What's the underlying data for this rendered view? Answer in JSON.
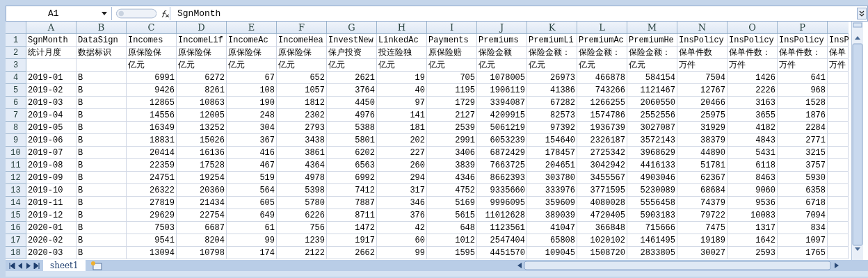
{
  "name_box": "A1",
  "formula": "SgnMonth",
  "columns": [
    "A",
    "B",
    "C",
    "D",
    "E",
    "F",
    "G",
    "H",
    "I",
    "J",
    "K",
    "L",
    "M",
    "N",
    "O",
    "P"
  ],
  "rows": [
    {
      "number": "1",
      "cells": [
        "SgnMonth",
        "DataSign",
        "Incomes",
        "IncomeLif",
        "IncomeAc",
        "IncomeHea",
        "InvestNew",
        "LinkedAc",
        "Payments",
        "Premiums",
        "PremiumLi",
        "PremiumAc",
        "PremiumHe",
        "InsPolicy",
        "InsPolicy",
        "InsPolicy",
        "InsP"
      ]
    },
    {
      "number": "2",
      "cells": [
        "统计月度",
        "数据标识",
        "原保险保",
        "原保险保",
        "原保险保",
        "原保险保",
        "保户投资",
        "投连险独",
        "原保险赔",
        "保险金额",
        "保险金额：",
        "保险金额：",
        "保险金额：",
        "保单件数",
        "保单件数：",
        "保单件数：",
        "保单"
      ]
    },
    {
      "number": "3",
      "cells": [
        null,
        null,
        "亿元",
        "亿元",
        "亿元",
        "亿元",
        "亿元",
        "亿元",
        "亿元",
        "亿元",
        "亿元",
        "亿元",
        "亿元",
        "万件",
        "万件",
        "万件",
        "万件"
      ]
    },
    {
      "number": "4",
      "cells": [
        "2019-01",
        "B",
        "6991",
        "6272",
        "67",
        "652",
        "2621",
        "19",
        "705",
        "1078005",
        "26973",
        "466878",
        "584154",
        "7504",
        "1426",
        "641"
      ]
    },
    {
      "number": "5",
      "cells": [
        "2019-02",
        "B",
        "9426",
        "8261",
        "108",
        "1057",
        "3764",
        "40",
        "1195",
        "1906119",
        "41386",
        "743266",
        "1121467",
        "12767",
        "2226",
        "968"
      ]
    },
    {
      "number": "6",
      "cells": [
        "2019-03",
        "B",
        "12865",
        "10863",
        "190",
        "1812",
        "4450",
        "97",
        "1729",
        "3394087",
        "67282",
        "1266255",
        "2060550",
        "20466",
        "3163",
        "1528"
      ]
    },
    {
      "number": "7",
      "cells": [
        "2019-04",
        "B",
        "14556",
        "12005",
        "248",
        "2302",
        "4976",
        "141",
        "2127",
        "4209915",
        "82573",
        "1574786",
        "2552556",
        "25975",
        "3655",
        "1876"
      ]
    },
    {
      "number": "8",
      "cells": [
        "2019-05",
        "B",
        "16349",
        "13252",
        "304",
        "2793",
        "5388",
        "181",
        "2539",
        "5061219",
        "97392",
        "1936739",
        "3027087",
        "31929",
        "4182",
        "2284"
      ]
    },
    {
      "number": "9",
      "cells": [
        "2019-06",
        "B",
        "18831",
        "15026",
        "367",
        "3438",
        "5801",
        "202",
        "2991",
        "6053239",
        "154640",
        "2326187",
        "3572143",
        "38379",
        "4843",
        "2771"
      ]
    },
    {
      "number": "10",
      "cells": [
        "2019-07",
        "B",
        "20414",
        "16136",
        "416",
        "3861",
        "6202",
        "227",
        "3406",
        "6872429",
        "178457",
        "2725342",
        "3968629",
        "44890",
        "5431",
        "3215"
      ]
    },
    {
      "number": "11",
      "cells": [
        "2019-08",
        "B",
        "22359",
        "17528",
        "467",
        "4364",
        "6563",
        "260",
        "3839",
        "7663725",
        "204651",
        "3042942",
        "4416133",
        "51781",
        "6118",
        "3757"
      ]
    },
    {
      "number": "12",
      "cells": [
        "2019-09",
        "B",
        "24751",
        "19254",
        "519",
        "4978",
        "6992",
        "294",
        "4346",
        "8662393",
        "303780",
        "3455567",
        "4903046",
        "62367",
        "8463",
        "5930"
      ]
    },
    {
      "number": "13",
      "cells": [
        "2019-10",
        "B",
        "26322",
        "20360",
        "564",
        "5398",
        "7412",
        "317",
        "4752",
        "9335660",
        "333976",
        "3771595",
        "5230089",
        "68684",
        "9060",
        "6358"
      ]
    },
    {
      "number": "14",
      "cells": [
        "2019-11",
        "B",
        "27819",
        "21434",
        "605",
        "5780",
        "7887",
        "346",
        "5169",
        "9996095",
        "359609",
        "4080028",
        "5556458",
        "74379",
        "9536",
        "6718"
      ]
    },
    {
      "number": "15",
      "cells": [
        "2019-12",
        "B",
        "29629",
        "22754",
        "649",
        "6226",
        "8711",
        "376",
        "5615",
        "11012628",
        "389039",
        "4720405",
        "5903183",
        "79722",
        "10083",
        "7094"
      ]
    },
    {
      "number": "16",
      "cells": [
        "2020-01",
        "B",
        "7503",
        "6687",
        "61",
        "756",
        "1472",
        "42",
        "648",
        "1123561",
        "41047",
        "366848",
        "715666",
        "7475",
        "1317",
        "834"
      ]
    },
    {
      "number": "17",
      "cells": [
        "2020-02",
        "B",
        "9541",
        "8204",
        "99",
        "1239",
        "1917",
        "60",
        "1012",
        "2547404",
        "65808",
        "1020102",
        "1461495",
        "19189",
        "1642",
        "1097"
      ]
    },
    {
      "number": "18",
      "cells": [
        "2020-03",
        "B",
        "13094",
        "10798",
        "174",
        "2122",
        "2662",
        "99",
        "1595",
        "4451570",
        "109045",
        "1508720",
        "2833805",
        "30027",
        "2593",
        "1765"
      ]
    }
  ],
  "sheet_tabs": [
    {
      "label": "sheet1",
      "selected": true
    }
  ]
}
